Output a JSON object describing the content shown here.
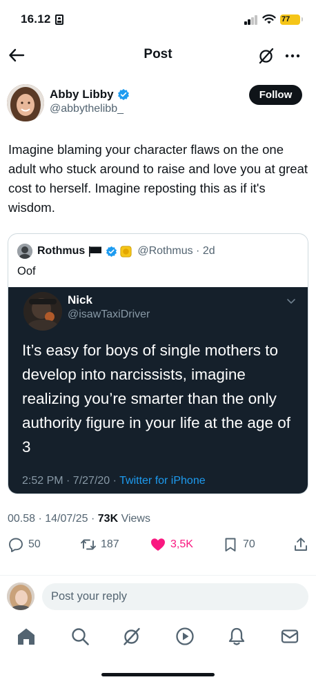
{
  "status_bar": {
    "time": "16.12",
    "battery": "77"
  },
  "header": {
    "title": "Post"
  },
  "post": {
    "author_name": "Abby Libby",
    "author_handle": "@abbythelibb_",
    "follow_label": "Follow",
    "text": "Imagine blaming your character flaws on the one adult who stuck around to raise and love you at great cost to herself. Imagine reposting this as if it's wisdom.",
    "timestamp": "00.58 · 14/07/25 · ",
    "views_count": "73K",
    "views_label": " Views"
  },
  "quote": {
    "author_name": "Rothmus",
    "handle_time": "@Rothmus · 2d",
    "text": "Oof",
    "embedded": {
      "author_name": "Nick",
      "author_handle": "@isawTaxiDriver",
      "text": "It’s easy for boys of single mothers to develop into narcissists, imagine realizing you’re smarter than the only authority figure in your life at the age of 3",
      "meta": "2:52 PM · 7/27/20 · ",
      "source": "Twitter for iPhone"
    }
  },
  "actions": {
    "replies": "50",
    "reposts": "187",
    "likes": "3,5K",
    "bookmarks": "70"
  },
  "reply": {
    "placeholder": "Post your reply"
  },
  "icons": {
    "back": "back-arrow-icon",
    "grok": "grok-icon",
    "more": "more-icon",
    "verified": "verified-icon",
    "flag": "black-flag-icon",
    "gold_badge": "gold-badge-icon",
    "reply": "reply-icon",
    "repost": "repost-icon",
    "like": "heart-icon",
    "bookmark": "bookmark-icon",
    "share": "share-icon",
    "nav": [
      "home-icon",
      "search-icon",
      "grok-icon",
      "video-icon",
      "notifications-icon",
      "messages-icon"
    ]
  },
  "colors": {
    "accent": "#1d9bf0",
    "like": "#f91880",
    "text": "#0f1419",
    "secondary": "#536471",
    "embedded_bg": "#15202b",
    "battery": "#f5c518"
  }
}
